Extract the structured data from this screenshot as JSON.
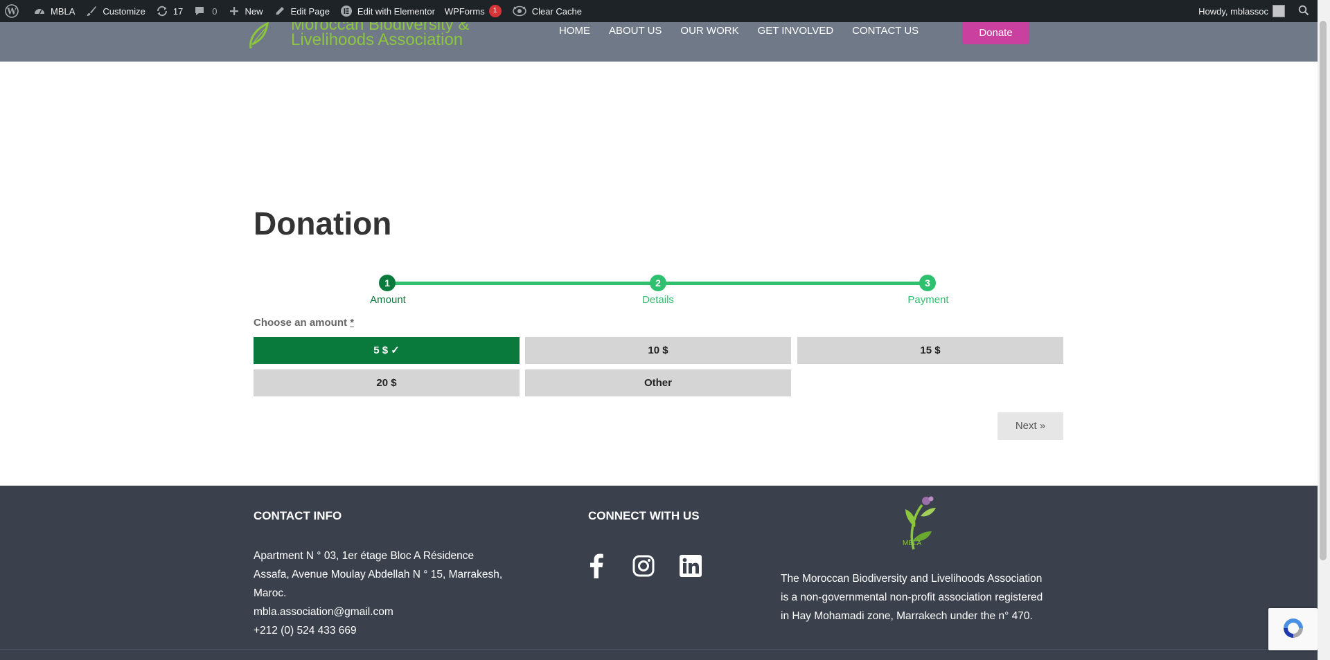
{
  "admin_bar": {
    "site_name": "MBLA",
    "customize": "Customize",
    "updates_count": "17",
    "comments_count": "0",
    "new": "New",
    "edit_page": "Edit Page",
    "edit_elementor": "Edit with Elementor",
    "wpforms": "WPForms",
    "wpforms_badge": "1",
    "clear_cache": "Clear Cache",
    "howdy": "Howdy, mblassoc"
  },
  "header": {
    "logo_line1": "Moroccan Biodiversity &",
    "logo_line2": "Livelihoods Association",
    "nav": [
      "HOME",
      "ABOUT US",
      "OUR WORK",
      "GET INVOLVED",
      "CONTACT US"
    ],
    "donate": "Donate"
  },
  "main": {
    "title": "Donation",
    "steps": [
      {
        "number": "1",
        "label": "Amount",
        "state": "current"
      },
      {
        "number": "2",
        "label": "Details",
        "state": "upcoming"
      },
      {
        "number": "3",
        "label": "Payment",
        "state": "upcoming"
      }
    ],
    "choose_label": "Choose an amount",
    "required_marker": "*",
    "amounts": [
      "5 $",
      "10 $",
      "15 $",
      "20 $",
      "Other"
    ],
    "selected_amount": "5 $",
    "selected_check": "✓",
    "next": "Next »"
  },
  "footer": {
    "contact_heading": "CONTACT INFO",
    "address_line1": "Apartment N ° 03, 1er étage Bloc A Résidence",
    "address_line2": "Assafa, Avenue Moulay Abdellah N ° 15, Marrakesh,",
    "address_line3": "Maroc.",
    "email": "mbla.association@gmail.com",
    "phone": "+212 (0) 524 433 669",
    "connect_heading": "CONNECT WITH US",
    "logo_text": "MBLA",
    "about_line1": "The Moroccan Biodiversity and Livelihoods Association",
    "about_line2": "is a non-governmental non-profit association registered",
    "about_line3": "in Hay Mohamadi zone, Marrakech under the n° 470."
  },
  "colors": {
    "admin_bar": "#1d2327",
    "header_bg": "#6f7987",
    "logo_green": "#8cc63f",
    "donate_pink": "#c9409f",
    "step_current": "#0a7a3c",
    "step_track": "#2ebf6f",
    "footer_bg": "#3a414d"
  },
  "icons": [
    "wordpress-icon",
    "dashboard-icon",
    "brush-icon",
    "updates-icon",
    "comment-icon",
    "plus-icon",
    "pencil-icon",
    "elementor-icon",
    "cache-icon",
    "search-icon",
    "facebook-icon",
    "instagram-icon",
    "linkedin-icon",
    "recaptcha-icon"
  ]
}
